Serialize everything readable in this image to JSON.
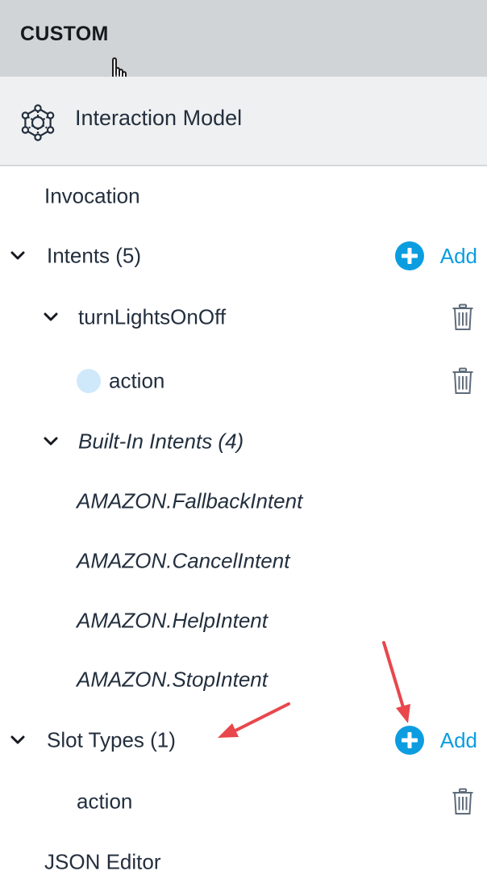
{
  "header": {
    "title": "CUSTOM"
  },
  "section": {
    "label": "Interaction Model",
    "icon": "interaction-model-icon"
  },
  "nav": {
    "invocation": "Invocation",
    "intents": {
      "label": "Intents (5)",
      "add_label": "Add",
      "items": [
        {
          "label": "turnLightsOnOff",
          "slots": [
            {
              "label": "action"
            }
          ]
        }
      ],
      "builtin": {
        "label": "Built-In Intents (4)",
        "items": [
          "AMAZON.FallbackIntent",
          "AMAZON.CancelIntent",
          "AMAZON.HelpIntent",
          "AMAZON.StopIntent"
        ]
      }
    },
    "slot_types": {
      "label": "Slot Types (1)",
      "add_label": "Add",
      "items": [
        {
          "label": "action"
        }
      ]
    },
    "json_editor": "JSON Editor"
  },
  "colors": {
    "header_bg": "#d1d4d6",
    "section_bg": "#eff0f1",
    "accent": "#0b9de0",
    "slot_dot": "#cfe9fb",
    "annotation_arrow": "#e8474c",
    "text": "#232f3e"
  }
}
